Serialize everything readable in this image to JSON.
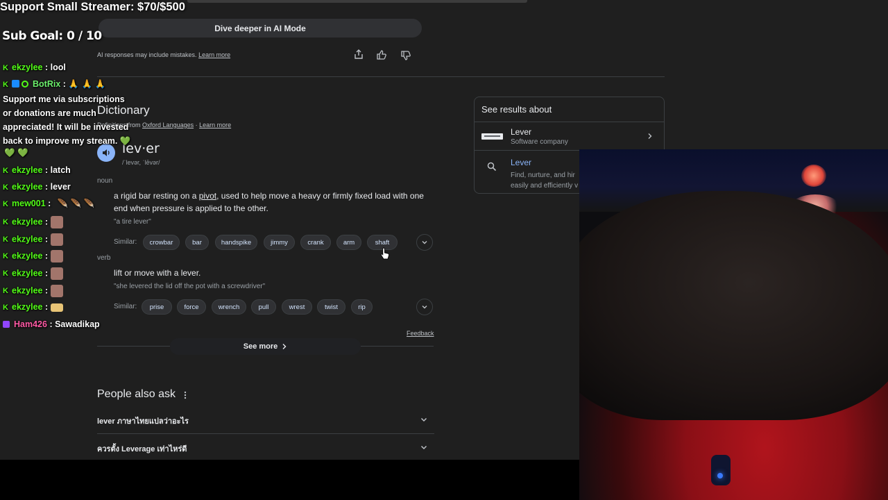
{
  "overlay": {
    "support_goal": "Support Small Streamer: $70/$500",
    "sub_goal": "Sub Goal:  0 / 10"
  },
  "chat": [
    {
      "user": "ekzylee",
      "msg": ": lool"
    },
    {
      "user": "BotRix",
      "msg": ": 🙏 🙏 🙏"
    },
    {
      "user": "",
      "msg": "Support me via subscriptions or donations are much appreciated! It will be invested back to improve my stream. 💚"
    },
    {
      "user": "",
      "msg": "💚 💚"
    },
    {
      "user": "ekzylee",
      "msg": ": latch"
    },
    {
      "user": "ekzylee",
      "msg": ": lever"
    },
    {
      "user": "mew001",
      "msg": ":"
    },
    {
      "user": "ekzylee",
      "msg": ":"
    },
    {
      "user": "ekzylee",
      "msg": ":"
    },
    {
      "user": "ekzylee",
      "msg": ":"
    },
    {
      "user": "ekzylee",
      "msg": ":"
    },
    {
      "user": "ekzylee",
      "msg": ":"
    },
    {
      "user": "ekzylee",
      "msg": ":"
    },
    {
      "user": "Ham426",
      "msg": ": Sawadikap"
    }
  ],
  "ai": {
    "dive_deeper": "Dive deeper in AI Mode",
    "disclaimer": "AI responses may include mistakes.",
    "learn_more": "Learn more"
  },
  "dictionary": {
    "title": "Dictionary",
    "source_prefix": "Definitions from",
    "source": "Oxford Languages",
    "learn_more": "Learn more",
    "word": "lev·er",
    "phonetic": "/ˈlevər, ˈlēvər/",
    "noun_label": "noun",
    "noun_def_1": "a rigid bar resting on a ",
    "noun_def_link": "pivot",
    "noun_def_2": ", used to help move a heavy or firmly fixed load with one",
    "noun_def_3": "end when pressure is applied to the other.",
    "noun_example": "\"a tire lever\"",
    "similar_label": "Similar:",
    "noun_similar": [
      "crowbar",
      "bar",
      "handspike",
      "jimmy",
      "crank",
      "arm",
      "shaft"
    ],
    "verb_label": "verb",
    "verb_def": "lift or move with a lever.",
    "verb_example": "\"she levered the lid off the pot with a screwdriver\"",
    "verb_similar": [
      "prise",
      "force",
      "wrench",
      "pull",
      "wrest",
      "twist",
      "rip"
    ],
    "feedback": "Feedback",
    "see_more": "See more"
  },
  "paa": {
    "title": "People also ask",
    "questions": [
      "lever ภาษาไทยแปลว่าอะไร",
      "ควรตั้ง Leverage เท่าไหร่ดี"
    ]
  },
  "results_about": {
    "title": "See results about",
    "items": [
      {
        "name": "Lever",
        "desc": "Software company"
      },
      {
        "name": "Lever",
        "desc_1": "Find, nurture, and hir",
        "desc_2": "easily and efficiently v"
      }
    ]
  },
  "colors": {
    "link_blue": "#8ab4f8",
    "kick_green": "#53fc18",
    "botrix_green": "#6cf06c",
    "ham_pink": "#ff5aa5"
  }
}
